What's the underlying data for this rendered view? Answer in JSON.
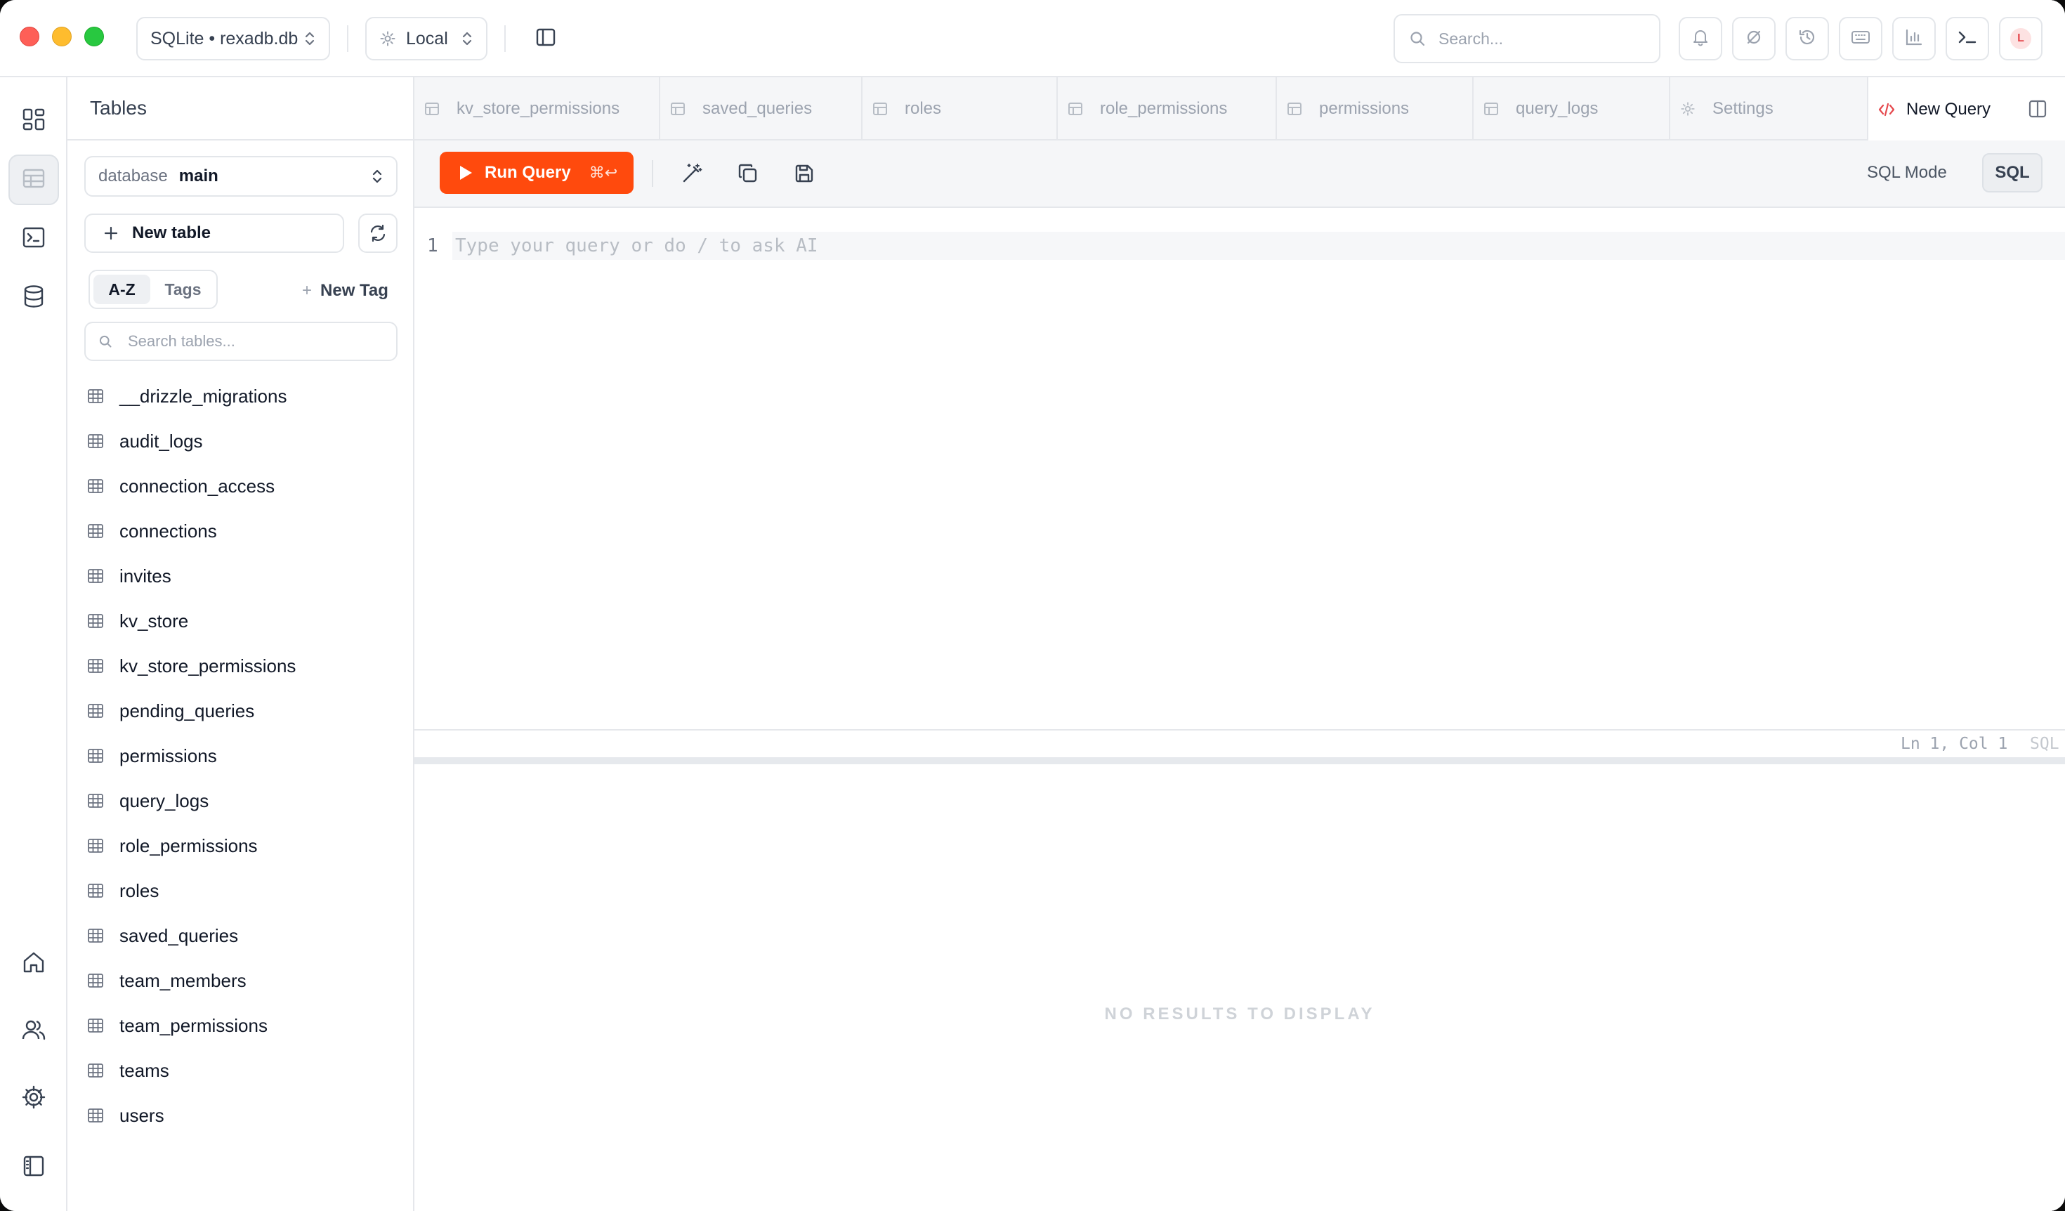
{
  "titlebar": {
    "connection_label": "SQLite • rexadb.db",
    "environment_label": "Local",
    "search_placeholder": "Search...",
    "avatar_letter": "L",
    "colors": {
      "avatar": "#e5484d"
    }
  },
  "rail": {
    "top_items": [
      "dashboard-icon",
      "table-icon",
      "terminal-icon",
      "database-icon"
    ],
    "bottom_items": [
      "home-icon",
      "users-icon",
      "gear-icon",
      "sidebar-book-icon"
    ]
  },
  "sidebar": {
    "title": "Tables",
    "database_label": "database",
    "database_value": "main",
    "new_table_label": "New table",
    "sort_tabs": [
      "A-Z",
      "Tags"
    ],
    "new_tag_label": "New Tag",
    "search_placeholder": "Search tables...",
    "tables": [
      "__drizzle_migrations",
      "audit_logs",
      "connection_access",
      "connections",
      "invites",
      "kv_store",
      "kv_store_permissions",
      "pending_queries",
      "permissions",
      "query_logs",
      "role_permissions",
      "roles",
      "saved_queries",
      "team_members",
      "team_permissions",
      "teams",
      "users"
    ]
  },
  "tabs": [
    {
      "label": "kv_store_permissions",
      "icon": "table-icon"
    },
    {
      "label": "saved_queries",
      "icon": "table-icon"
    },
    {
      "label": "roles",
      "icon": "table-icon"
    },
    {
      "label": "role_permissions",
      "icon": "table-icon"
    },
    {
      "label": "permissions",
      "icon": "table-icon"
    },
    {
      "label": "query_logs",
      "icon": "table-icon"
    },
    {
      "label": "Settings",
      "icon": "gear-icon"
    },
    {
      "label": "New Query",
      "icon": "code-icon",
      "active": true
    }
  ],
  "toolbar": {
    "run_label": "Run Query",
    "run_shortcut": "⌘↩",
    "sql_mode_label": "SQL Mode",
    "sql_badge": "SQL",
    "colors": {
      "run": "#ff4a0d"
    }
  },
  "editor": {
    "line_number": "1",
    "placeholder": "Type your query or do / to ask AI",
    "cursor_position": "Ln 1, Col 1",
    "language": "SQL"
  },
  "results": {
    "empty_message": "NO RESULTS TO DISPLAY"
  }
}
